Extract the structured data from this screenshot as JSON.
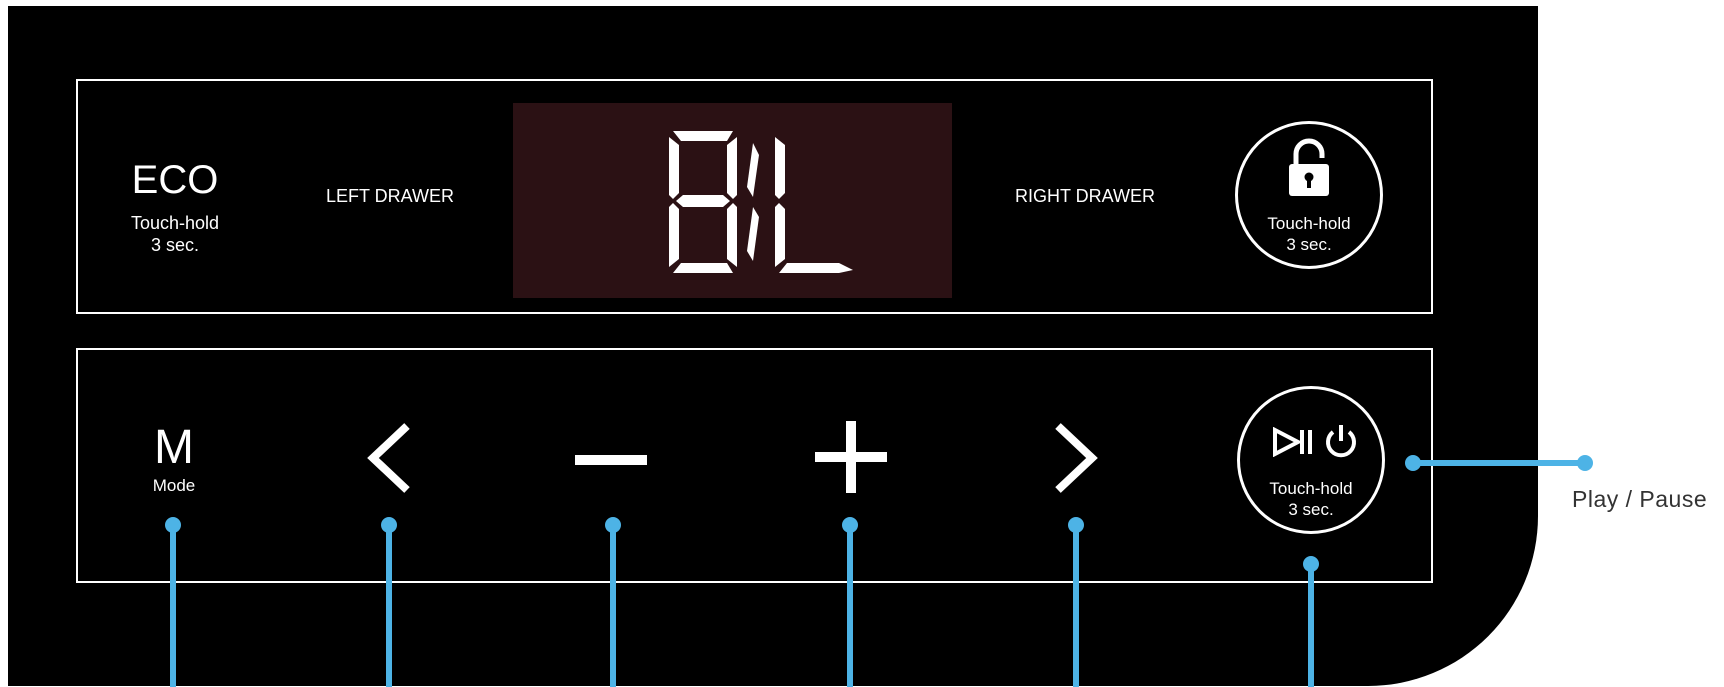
{
  "panel": {
    "eco": {
      "title": "ECO",
      "hint_line1": "Touch-hold",
      "hint_line2": "3 sec."
    },
    "left_drawer_label": "LEFT DRAWER",
    "right_drawer_label": "RIGHT DRAWER",
    "display": {
      "digits": "8L"
    },
    "lock": {
      "icon": "unlock-icon",
      "hint_line1": "Touch-hold",
      "hint_line2": "3 sec."
    }
  },
  "controls": {
    "mode": {
      "letter": "M",
      "label": "Mode"
    },
    "prev": {
      "icon": "chevron-left-icon"
    },
    "minus": {
      "icon": "minus-icon"
    },
    "plus": {
      "icon": "plus-icon"
    },
    "next": {
      "icon": "chevron-right-icon"
    },
    "play_power": {
      "icons": [
        "play-pause-icon",
        "power-icon"
      ],
      "hint_line1": "Touch-hold",
      "hint_line2": "3 sec."
    }
  },
  "callouts": {
    "play_pause": "Play / Pause"
  },
  "colors": {
    "panel": "#000000",
    "display_bg": "#2b1114",
    "callout": "#4db3e6",
    "text": "#ffffff"
  }
}
